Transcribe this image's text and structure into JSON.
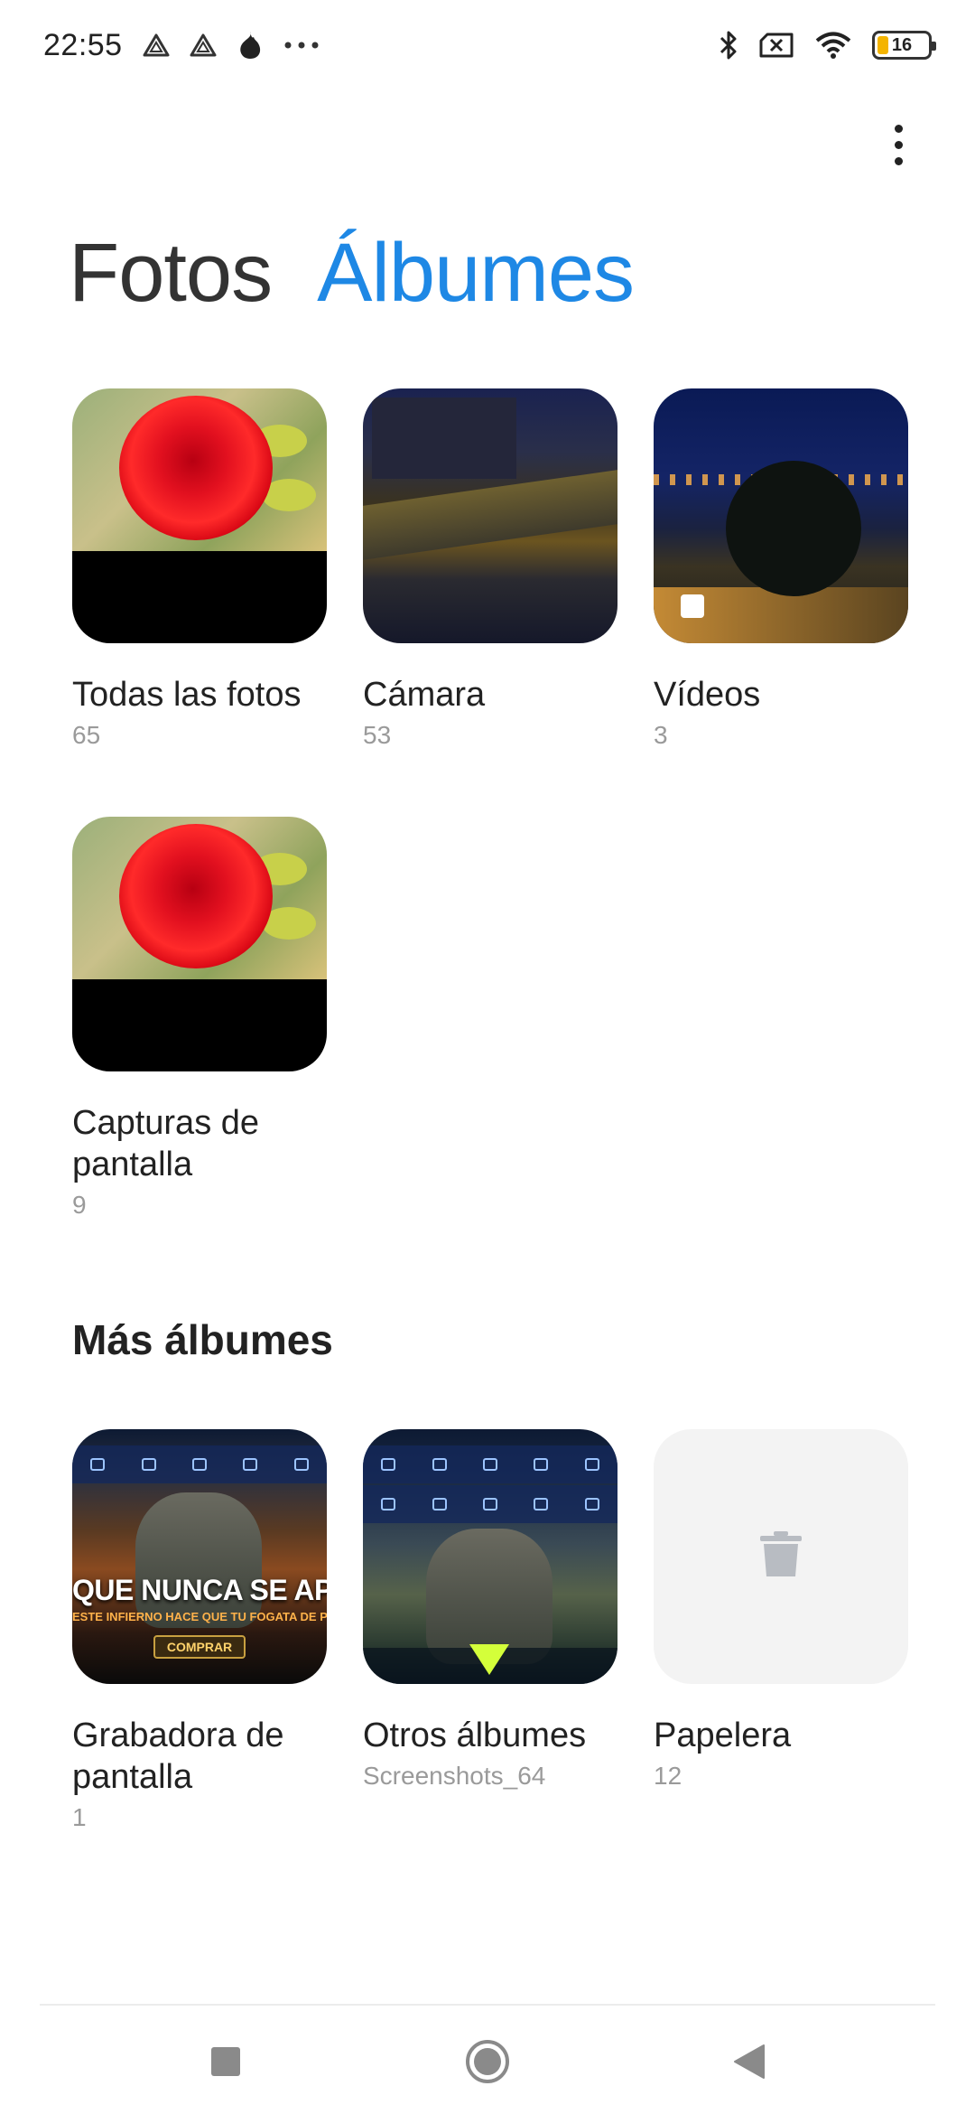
{
  "status_bar": {
    "time": "22:55",
    "left_icons": [
      "triangle-alert-icon",
      "triangle-alert-icon",
      "flame-icon",
      "more-dots-icon"
    ],
    "right_icons": [
      "bluetooth-icon",
      "no-sim-icon",
      "wifi-icon",
      "battery-icon"
    ],
    "battery_level": "16",
    "battery_color": "#f4b400"
  },
  "header": {
    "menu_icon": "more-vert-icon"
  },
  "tabs": [
    {
      "label": "Fotos",
      "active": false,
      "color": "#333333"
    },
    {
      "label": "Álbumes",
      "active": true,
      "color": "#1e88e5"
    }
  ],
  "albums": [
    {
      "name": "Todas las fotos",
      "count": "65",
      "thumbnail": "red-rose-photo"
    },
    {
      "name": "Cámara",
      "count": "53",
      "thumbnail": "night-street-photo"
    },
    {
      "name": "Vídeos",
      "count": "3",
      "thumbnail": "night-city-photo"
    },
    {
      "name": "Capturas de pantalla",
      "count": "9",
      "thumbnail": "red-rose-photo"
    }
  ],
  "more_albums": {
    "title": "Más álbumes",
    "items": [
      {
        "name": "Grabadora de pantalla",
        "count": "1",
        "thumbnail": "game-screenshot"
      },
      {
        "name": "Otros álbumes",
        "count": "Screenshots_64",
        "thumbnail": "game-screenshot"
      },
      {
        "name": "Papelera",
        "count": "12",
        "thumbnail": "trash-icon"
      }
    ],
    "game_banner": {
      "headline": "QUE NUNCA SE APAGUE",
      "subline": "ESTE INFIERNO HACE QUE TU FOGATA DE PENA",
      "button": "COMPRAR"
    }
  },
  "nav_bar": {
    "buttons": [
      "recents-square-icon",
      "home-circle-icon",
      "back-triangle-icon"
    ]
  }
}
